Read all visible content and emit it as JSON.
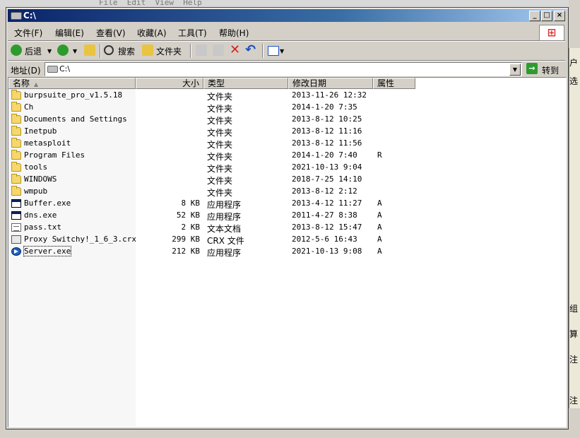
{
  "background": {
    "menu_text": "File  Edit  View  Help",
    "right_glyphs": [
      "户",
      "选",
      "组",
      "算",
      "注",
      "注"
    ]
  },
  "window": {
    "title": "C:\\",
    "controls": {
      "minimize": "_",
      "maximize": "□",
      "close": "×"
    }
  },
  "menubar": {
    "items": [
      "文件(F)",
      "编辑(E)",
      "查看(V)",
      "收藏(A)",
      "工具(T)",
      "帮助(H)"
    ]
  },
  "toolbar": {
    "back_label": "后退",
    "search_label": "搜索",
    "folders_label": "文件夹"
  },
  "address": {
    "label": "地址(D)",
    "value": "C:\\",
    "go_label": "转到"
  },
  "columns": {
    "name": "名称",
    "size": "大小",
    "type": "类型",
    "modified": "修改日期",
    "attributes": "属性"
  },
  "files": [
    {
      "name": "burpsuite_pro_v1.5.18",
      "size": "",
      "type": "文件夹",
      "modified": "2013-11-26 12:32",
      "attr": "",
      "icon": "folder-icon"
    },
    {
      "name": "Ch",
      "size": "",
      "type": "文件夹",
      "modified": "2014-1-20 7:35",
      "attr": "",
      "icon": "folder-icon"
    },
    {
      "name": "Documents and Settings",
      "size": "",
      "type": "文件夹",
      "modified": "2013-8-12 10:25",
      "attr": "",
      "icon": "folder-icon"
    },
    {
      "name": "Inetpub",
      "size": "",
      "type": "文件夹",
      "modified": "2013-8-12 11:16",
      "attr": "",
      "icon": "folder-icon"
    },
    {
      "name": "metasploit",
      "size": "",
      "type": "文件夹",
      "modified": "2013-8-12 11:56",
      "attr": "",
      "icon": "folder-icon"
    },
    {
      "name": "Program Files",
      "size": "",
      "type": "文件夹",
      "modified": "2014-1-20 7:40",
      "attr": "R",
      "icon": "folder-icon"
    },
    {
      "name": "tools",
      "size": "",
      "type": "文件夹",
      "modified": "2021-10-13 9:04",
      "attr": "",
      "icon": "folder-icon"
    },
    {
      "name": "WINDOWS",
      "size": "",
      "type": "文件夹",
      "modified": "2018-7-25 14:10",
      "attr": "",
      "icon": "folder-icon"
    },
    {
      "name": "wmpub",
      "size": "",
      "type": "文件夹",
      "modified": "2013-8-12 2:12",
      "attr": "",
      "icon": "folder-icon"
    },
    {
      "name": "Buffer.exe",
      "size": "8 KB",
      "type": "应用程序",
      "modified": "2013-4-12 11:27",
      "attr": "A",
      "icon": "exe-icon"
    },
    {
      "name": "dns.exe",
      "size": "52 KB",
      "type": "应用程序",
      "modified": "2011-4-27 8:38",
      "attr": "A",
      "icon": "exe-icon"
    },
    {
      "name": "pass.txt",
      "size": "2 KB",
      "type": "文本文档",
      "modified": "2013-8-12 15:47",
      "attr": "A",
      "icon": "text-file-icon"
    },
    {
      "name": "Proxy Switchy!_1_6_3.crx",
      "size": "299 KB",
      "type": "CRX 文件",
      "modified": "2012-5-6 16:43",
      "attr": "A",
      "icon": "crx-file-icon"
    },
    {
      "name": "Server.exe",
      "size": "212 KB",
      "type": "应用程序",
      "modified": "2021-10-13 9:08",
      "attr": "A",
      "icon": "server-exe-icon"
    }
  ]
}
